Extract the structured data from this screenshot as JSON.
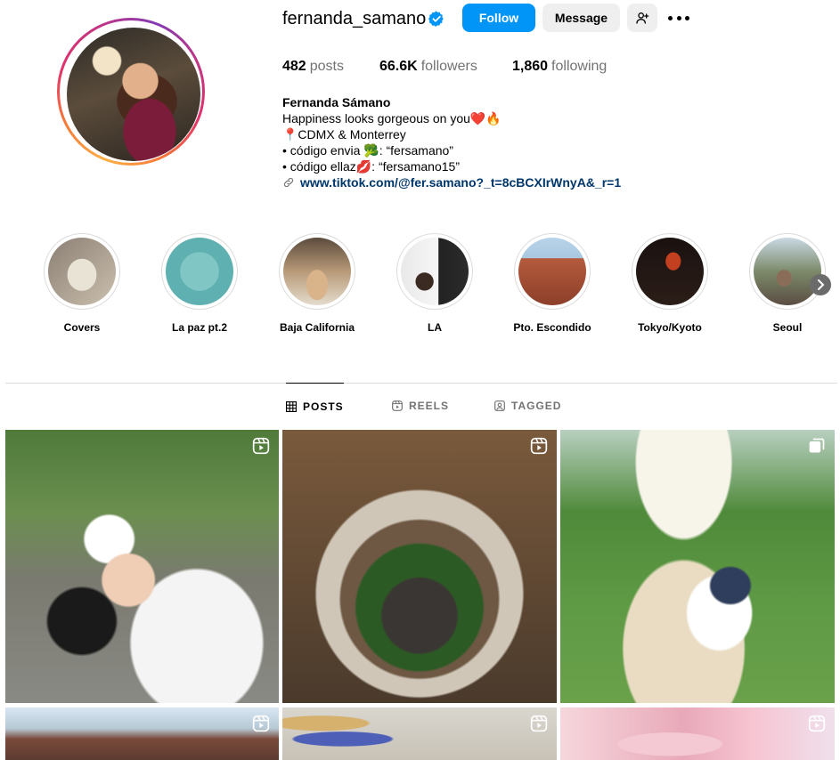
{
  "profile": {
    "username": "fernanda_samano",
    "follow_label": "Follow",
    "message_label": "Message",
    "stats": {
      "posts_count": "482",
      "posts_label": "posts",
      "followers_count": "66.6K",
      "followers_label": "followers",
      "following_count": "1,860",
      "following_label": "following"
    },
    "full_name": "Fernanda Sámano",
    "bio_lines": [
      "Happiness looks gorgeous on you❤️🔥",
      "📍CDMX & Monterrey",
      "• código envia 🥦: “fersamano”",
      "• código ellaz💋: “fersamano15”"
    ],
    "link": "www.tiktok.com/@fer.samano?_t=8cBCXIrWnyA&_r=1"
  },
  "highlights": [
    {
      "label": "Covers",
      "icon": "highlight-cover"
    },
    {
      "label": "La paz pt.2",
      "icon": "highlight-cover"
    },
    {
      "label": "Baja California",
      "icon": "highlight-cover"
    },
    {
      "label": "LA",
      "icon": "highlight-cover"
    },
    {
      "label": "Pto. Escondido",
      "icon": "highlight-cover"
    },
    {
      "label": "Tokyo/Kyoto",
      "icon": "highlight-cover"
    },
    {
      "label": "Seoul",
      "icon": "highlight-cover"
    }
  ],
  "tabs": {
    "posts": "POSTS",
    "reels": "REELS",
    "tagged": "TAGGED"
  },
  "colors": {
    "accent": "#0095f6",
    "link": "#00376b",
    "muted": "#737373",
    "button_bg": "#efefef",
    "verified": "#0095f6"
  },
  "posts": [
    {
      "badge": "reel-icon"
    },
    {
      "badge": "reel-icon"
    },
    {
      "badge": "carousel-icon"
    },
    {
      "badge": "reel-icon"
    },
    {
      "badge": "reel-icon"
    },
    {
      "badge": "reel-icon"
    }
  ]
}
